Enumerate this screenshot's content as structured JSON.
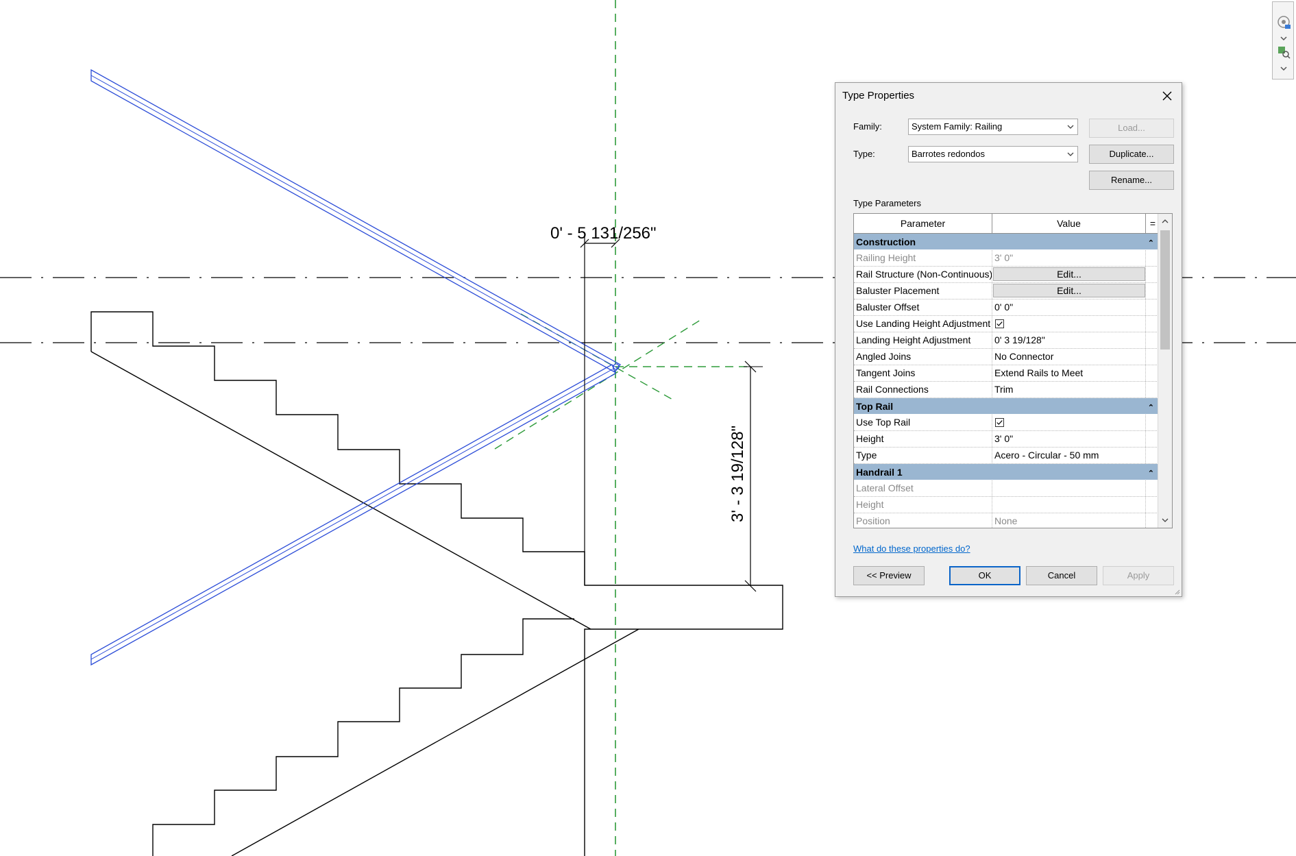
{
  "drawing": {
    "dimension_horizontal": "0' - 5 131/256\"",
    "dimension_vertical": "3' - 3 19/128\""
  },
  "dialog": {
    "title": "Type Properties",
    "family_label": "Family:",
    "family_value": "System Family: Railing",
    "type_label": "Type:",
    "type_value": "Barrotes redondos",
    "load_button": "Load...",
    "duplicate_button": "Duplicate...",
    "rename_button": "Rename...",
    "type_parameters_label": "Type Parameters",
    "columns": {
      "parameter": "Parameter",
      "value": "Value",
      "equals": "="
    },
    "sections": {
      "construction": "Construction",
      "top_rail": "Top Rail",
      "handrail_1": "Handrail 1"
    },
    "construction_rows": {
      "railing_height": {
        "param": "Railing Height",
        "value": "3'  0\""
      },
      "rail_structure": {
        "param": "Rail Structure (Non-Continuous)",
        "value": "Edit..."
      },
      "baluster_placement": {
        "param": "Baluster Placement",
        "value": "Edit..."
      },
      "baluster_offset": {
        "param": "Baluster Offset",
        "value": "0'  0\""
      },
      "use_landing_height": {
        "param": "Use Landing Height Adjustment",
        "checked": true
      },
      "landing_height_adjustment": {
        "param": "Landing Height Adjustment",
        "value": "0'  3 19/128\""
      },
      "angled_joins": {
        "param": "Angled Joins",
        "value": "No Connector"
      },
      "tangent_joins": {
        "param": "Tangent Joins",
        "value": "Extend Rails to Meet"
      },
      "rail_connections": {
        "param": "Rail Connections",
        "value": "Trim"
      }
    },
    "top_rail_rows": {
      "use_top_rail": {
        "param": "Use Top Rail",
        "checked": true
      },
      "height": {
        "param": "Height",
        "value": "3'  0\""
      },
      "type": {
        "param": "Type",
        "value": "Acero - Circular - 50 mm"
      }
    },
    "handrail_rows": {
      "lateral_offset": {
        "param": "Lateral Offset",
        "value": ""
      },
      "height": {
        "param": "Height",
        "value": ""
      },
      "position": {
        "param": "Position",
        "value": "None"
      }
    },
    "help_link": "What do these properties do?",
    "preview_button": "<< Preview",
    "ok_button": "OK",
    "cancel_button": "Cancel",
    "apply_button": "Apply"
  },
  "colors": {
    "railing_blue": "#2a4bd7",
    "reference_green": "#2e9b3a",
    "section_header": "#9ab6d1",
    "link_blue": "#0066cc"
  }
}
